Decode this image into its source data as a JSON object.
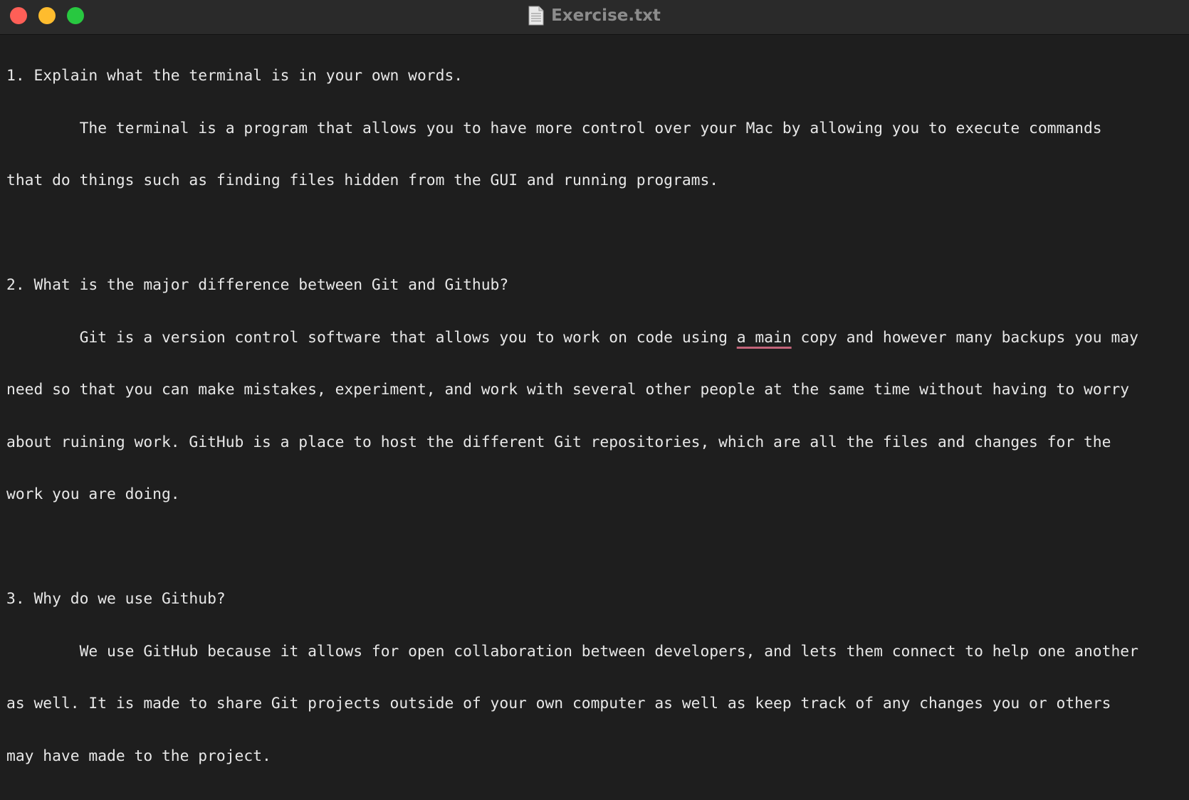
{
  "window": {
    "title": "Exercise.txt",
    "title_icon": "text-document-icon"
  },
  "document": {
    "lines": [
      "1. Explain what the terminal is in your own words.",
      "\tThe terminal is a program that allows you to have more control over your Mac by allowing you to execute commands",
      "that do things such as finding files hidden from the GUI and running programs.",
      "",
      "2. What is the major difference between Git and Github?",
      "\tGit is a version control software that allows you to work on code using ",
      "need so that you can make mistakes, experiment, and work with several other people at the same time without having to worry",
      "about ruining work. GitHub is a place to host the different Git repositories, which are all the files and changes for the",
      "work you are doing.",
      "",
      "3. Why do we use Github?",
      "\tWe use GitHub because it allows for open collaboration between developers, and lets them connect to help one another",
      "as well. It is made to share Git projects outside of your own computer as well as keep track of any changes you or others",
      "may have made to the project."
    ],
    "line6_flagged": "a main",
    "line6_tail": " copy and however many backups you may"
  },
  "colors": {
    "background": "#1e1e1e",
    "titlebar": "#2a2a2a",
    "text": "#e8e8e8",
    "title_text": "#8c8c8c",
    "spellcheck_underline": "#c26479",
    "close": "#ff5f57",
    "minimize": "#febc2e",
    "zoom": "#28c840"
  }
}
